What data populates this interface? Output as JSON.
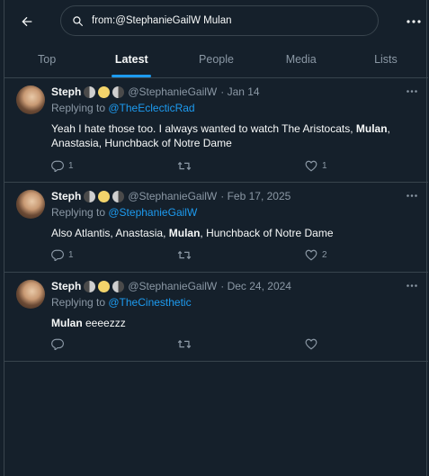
{
  "search": {
    "query": "from:@StephanieGailW Mulan"
  },
  "tabs": [
    {
      "label": "Top",
      "active": false
    },
    {
      "label": "Latest",
      "active": true
    },
    {
      "label": "People",
      "active": false
    },
    {
      "label": "Media",
      "active": false
    },
    {
      "label": "Lists",
      "active": false
    }
  ],
  "colors": {
    "background": "#15202b",
    "accent": "#1d9bf0",
    "border": "#38444d",
    "muted": "#8b98a5"
  },
  "icons": [
    "arrow-left-icon",
    "search-icon",
    "more-icon",
    "reply-icon",
    "retweet-icon",
    "like-icon"
  ],
  "tweets": [
    {
      "name": "Steph",
      "handle": "@StephanieGailW",
      "date": "· Jan 14",
      "replying_prefix": "Replying to ",
      "replying_to": "@TheEclecticRad",
      "text_parts": [
        "Yeah I hate those too. I always wanted to watch The Aristocats, ",
        "Mulan",
        ",",
        " Anastasia, Hunchback of Notre Dame"
      ],
      "replies": "1",
      "retweets": "",
      "likes": "1"
    },
    {
      "name": "Steph",
      "handle": "@StephanieGailW",
      "date": "· Feb 17, 2025",
      "replying_prefix": "Replying to ",
      "replying_to": "@StephanieGailW",
      "text_parts": [
        "Also Atlantis, Anastasia, ",
        "Mulan",
        ", Hunchback of Notre Dame"
      ],
      "replies": "1",
      "retweets": "",
      "likes": "2"
    },
    {
      "name": "Steph",
      "handle": "@StephanieGailW",
      "date": "· Dec 24, 2024",
      "replying_prefix": "Replying to ",
      "replying_to": "@TheCinesthetic",
      "text_parts": [
        "Mulan",
        " eeeezzz"
      ],
      "replies": "",
      "retweets": "",
      "likes": ""
    }
  ]
}
